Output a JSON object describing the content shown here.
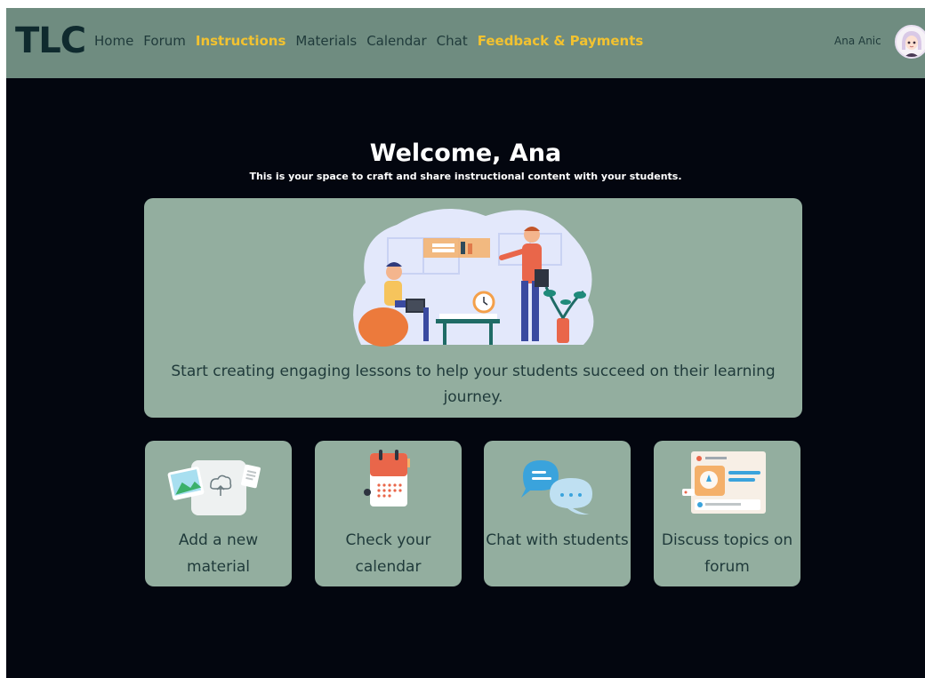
{
  "navbar": {
    "logo": "TLC",
    "links": [
      {
        "label": "Home",
        "active": false
      },
      {
        "label": "Forum",
        "active": false
      },
      {
        "label": "Instructions",
        "active": true
      },
      {
        "label": "Materials",
        "active": false
      },
      {
        "label": "Calendar",
        "active": false
      },
      {
        "label": "Chat",
        "active": false
      },
      {
        "label": "Feedback & Payments",
        "active": true
      }
    ],
    "user_name": "Ana Anic",
    "avatar_icon": "user-avatar-icon"
  },
  "welcome": {
    "title": "Welcome, Ana",
    "subtitle": "This is your space to craft and share instructional content with your students."
  },
  "hero": {
    "illustration": "teacher-student-illustration",
    "text": "Start creating engaging lessons to help your students succeed on their learning journey."
  },
  "cards": [
    {
      "label": "Add a new material",
      "icon": "upload-image-icon"
    },
    {
      "label": "Check your calendar",
      "icon": "calendar-icon"
    },
    {
      "label": "Chat with students",
      "icon": "chat-bubbles-icon"
    },
    {
      "label": "Discuss topics on forum",
      "icon": "forum-post-icon"
    }
  ],
  "colors": {
    "navbar": "#6f8c80",
    "background": "#03060f",
    "card": "#93ae9f",
    "accent": "#f2c230",
    "text_dark": "#1f3a3a"
  }
}
